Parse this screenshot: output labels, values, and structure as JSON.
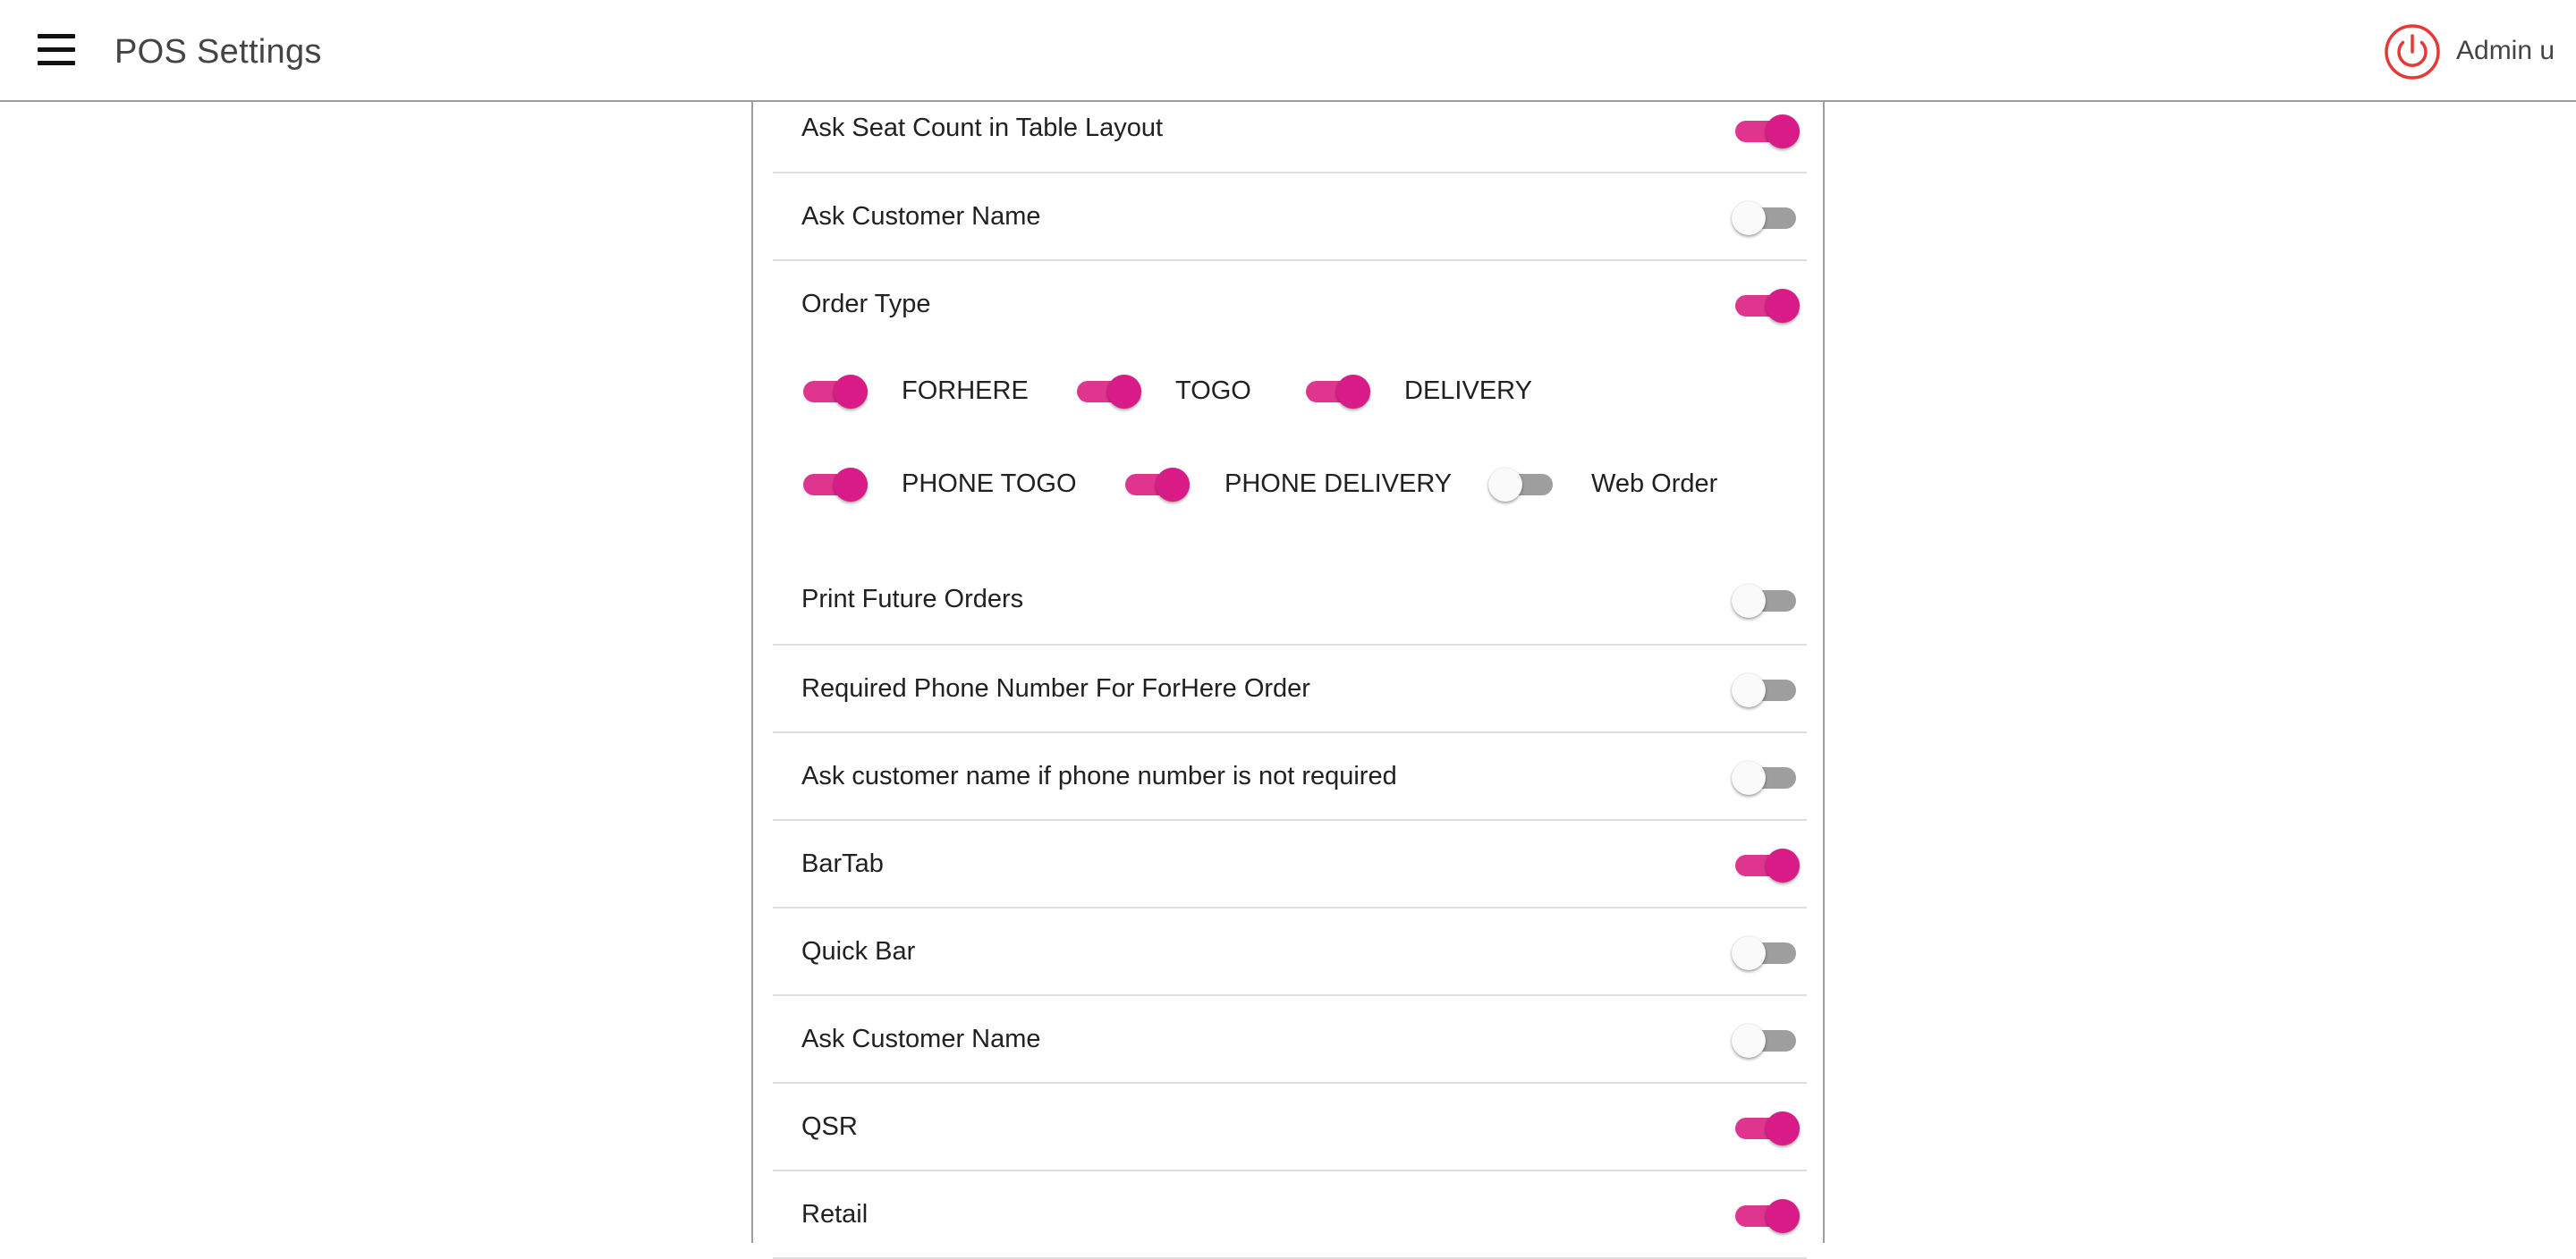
{
  "header": {
    "title": "POS Settings",
    "user": "Admin u",
    "menu_icon": "hamburger-menu-icon",
    "logout_icon": "power-icon",
    "accent_color": "#d81b87",
    "power_color": "#e53935"
  },
  "settings": [
    {
      "label": "Ask Seat Count in Table Layout",
      "on": true
    },
    {
      "label": "Ask Customer Name",
      "on": false
    },
    {
      "label": "Order Type",
      "on": true
    },
    {
      "label": "Print Future Orders",
      "on": false
    },
    {
      "label": "Required Phone Number For ForHere Order",
      "on": false
    },
    {
      "label": "Ask customer name if phone number is not required",
      "on": false
    },
    {
      "label": "BarTab",
      "on": true
    },
    {
      "label": "Quick Bar",
      "on": false
    },
    {
      "label": "Ask Customer Name",
      "on": false
    },
    {
      "label": "QSR",
      "on": true
    },
    {
      "label": "Retail",
      "on": true
    }
  ],
  "order_types": [
    {
      "label": "FORHERE",
      "on": true
    },
    {
      "label": "TOGO",
      "on": true
    },
    {
      "label": "DELIVERY",
      "on": true
    },
    {
      "label": "PHONE TOGO",
      "on": true
    },
    {
      "label": "PHONE DELIVERY",
      "on": true
    },
    {
      "label": "Web Order",
      "on": false
    }
  ]
}
